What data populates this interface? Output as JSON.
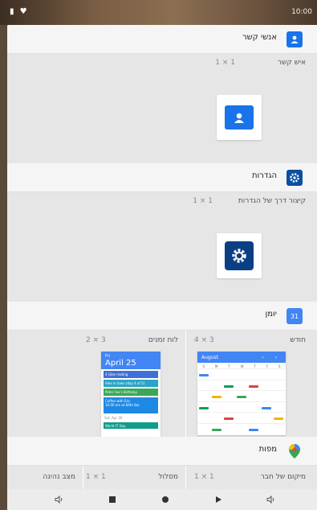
{
  "status_bar": {
    "time": "10:00",
    "left_icons": "▮ ♥"
  },
  "sections": {
    "contacts": {
      "title": "אנשי קשר",
      "widget_label": "איש קשר",
      "widget_size": "1 × 1"
    },
    "settings": {
      "title": "הגדרות",
      "widget_label": "קיצור דרך של הגדרות",
      "widget_size": "1 × 1"
    },
    "calendar": {
      "title": "יומן",
      "icon_text": "31",
      "month": {
        "label": "חודש",
        "size": "4 × 3",
        "header": "August",
        "days": [
          "S",
          "M",
          "T",
          "W",
          "T",
          "F",
          "S"
        ]
      },
      "schedule": {
        "label": "לוח זמנים",
        "size": "2 × 3",
        "day": "Fri",
        "date": "April 25",
        "events": [
          "4 Glee mating",
          "Alex in town (day 4 of 5)",
          "Peter Fox's Birthday",
          "Coffee with Eric",
          "10:00 am at 84th Bar"
        ],
        "next_day": "Sat, Apr 26",
        "next_event": "World IT Day"
      }
    },
    "maps": {
      "title": "מפות",
      "widgets": [
        {
          "label": "מיקום של חבר",
          "size": "1 × 1"
        },
        {
          "label": "מסלול",
          "size": "1 × 1"
        },
        {
          "label": "מצב נהיגה",
          "size": ""
        }
      ]
    }
  },
  "colors": {
    "accent": "#2b66c4",
    "contacts_icon": "#1a73e8",
    "settings_icon": "#0b4fa0",
    "calendar_blue": "#4285f4"
  }
}
